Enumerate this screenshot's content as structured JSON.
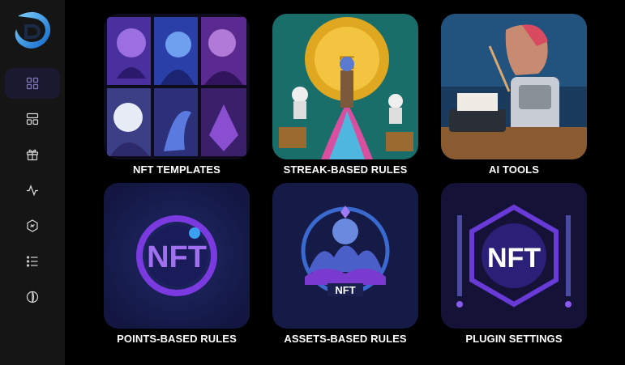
{
  "app": {
    "logo_icon": "d-swirl-logo-icon",
    "accent": "#1e90ff"
  },
  "sidebar": {
    "items": [
      {
        "id": "dashboard",
        "icon": "grid-icon",
        "active": true
      },
      {
        "id": "layout",
        "icon": "layout-icon",
        "active": false
      },
      {
        "id": "gifts",
        "icon": "gift-icon",
        "active": false
      },
      {
        "id": "activity",
        "icon": "activity-icon",
        "active": false
      },
      {
        "id": "blockchain",
        "icon": "hexagon-icon",
        "active": false
      },
      {
        "id": "list",
        "icon": "list-icon",
        "active": false
      },
      {
        "id": "theme",
        "icon": "contrast-icon",
        "active": false
      }
    ]
  },
  "cards": [
    {
      "label": "NFT TEMPLATES",
      "image": "nft-templates-artwork"
    },
    {
      "label": "STREAK-BASED RULES",
      "image": "streak-coin-artwork"
    },
    {
      "label": "AI TOOLS",
      "image": "ai-robot-artwork"
    },
    {
      "label": "POINTS-BASED RULES",
      "image": "nft-logo-artwork"
    },
    {
      "label": "ASSETS-BASED RULES",
      "image": "nft-emblem-artwork"
    },
    {
      "label": "PLUGIN SETTINGS",
      "image": "nft-plugin-artwork"
    }
  ]
}
